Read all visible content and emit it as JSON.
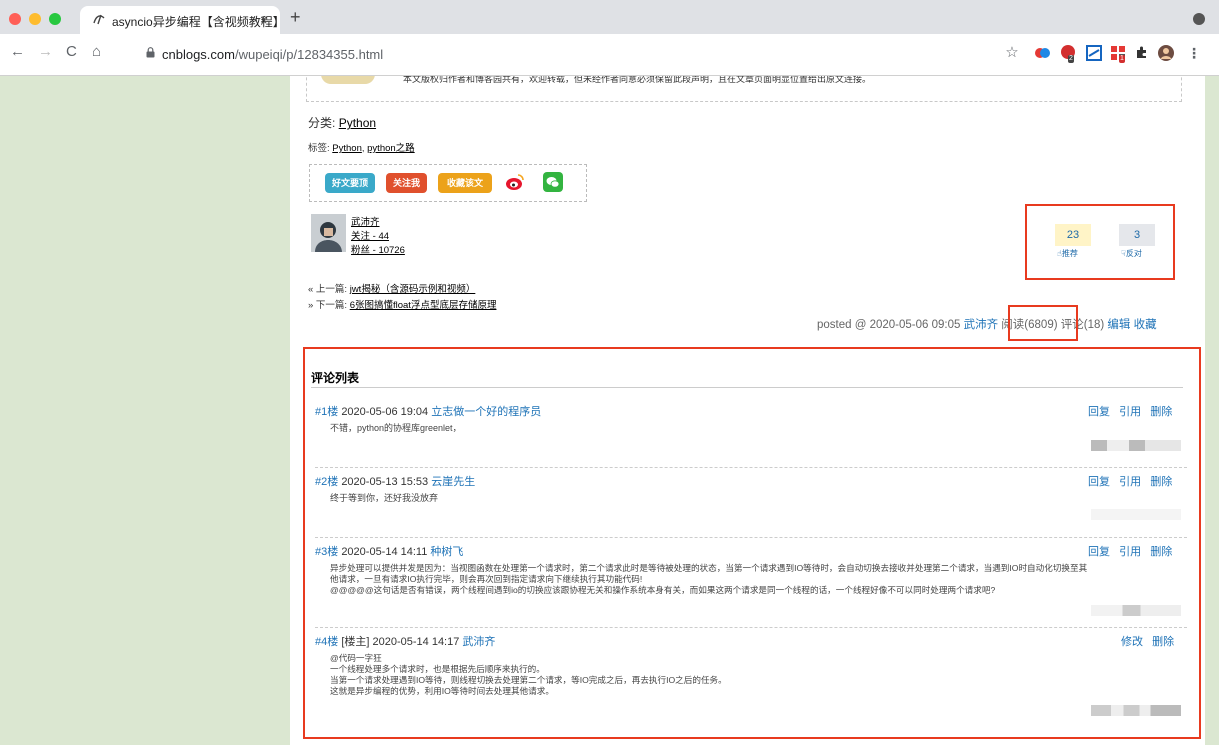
{
  "browser": {
    "tab_title": "asyncio异步编程【含视频教程】",
    "tab_close": "×",
    "new_tab": "+",
    "url_domain": "cnblogs.com",
    "url_path": "/wupeiqi/p/12834355.html",
    "nav": {
      "back": "←",
      "forward": "→",
      "reload": "C",
      "home": "⌂"
    },
    "toolbar_icons": [
      "star-icon",
      "extension-icon",
      "extension-icon",
      "extension-icon",
      "extension-icon",
      "puzzle-icon",
      "profile-icon",
      "menu-icon"
    ],
    "badges": [
      "2",
      "1"
    ]
  },
  "article": {
    "copyright": "本文版权归作者和博客园共有，欢迎转载，但未经作者同意必须保留此段声明，且在文章页面明显位置给出原文连接。",
    "category_label": "分类:",
    "category": "Python",
    "tags_label": "标签:",
    "tag1": "Python",
    "tag_sep": ",",
    "tag2": "python之路",
    "buttons": {
      "digg": "好文要顶",
      "follow": "关注我",
      "favorite": "收藏该文"
    },
    "author": {
      "name": "武沛齐",
      "follow": "关注 - 44",
      "fans": "粉丝 - 10726"
    },
    "votes": {
      "up": "23",
      "up_label": "推荐",
      "down": "3",
      "down_label": "反对"
    },
    "prev_label": "« 上一篇:",
    "prev_title": "jwt揭秘（含源码示例和视频）",
    "next_label": "» 下一篇:",
    "next_title": "6张图搞懂float浮点型底层存储原理",
    "postdesc": {
      "posted": "posted @ 2020-05-06 09:05",
      "author": "武沛齐",
      "read": "阅读(6809)",
      "comments": "评论(18)",
      "edit": "编辑",
      "collect": "收藏"
    }
  },
  "comments": {
    "title": "评论列表",
    "items": [
      {
        "num": "#1楼",
        "owner": "",
        "date": "2020-05-06 19:04",
        "user": "立志做一个好的程序员",
        "actions": [
          "回复",
          "引用",
          "删除"
        ],
        "lines": [
          "不错，python的协程库greenlet，"
        ]
      },
      {
        "num": "#2楼",
        "owner": "",
        "date": "2020-05-13 15:53",
        "user": "云崖先生",
        "actions": [
          "回复",
          "引用",
          "删除"
        ],
        "lines": [
          "终于等到你，还好我没放弃"
        ]
      },
      {
        "num": "#3楼",
        "owner": "",
        "date": "2020-05-14 14:11",
        "user": "种树飞",
        "actions": [
          "回复",
          "引用",
          "删除"
        ],
        "lines": [
          "异步处理可以提供并发是因为：当视图函数在处理第一个请求时，第二个请求此时是等待被处理的状态，当第一个请求遇到IO等待时，会自动切换去接收并处理第二个请求，当遇到IO时自动化切换至其",
          "他请求，一旦有请求IO执行完毕，则会再次回到指定请求向下继续执行其功能代码!",
          "@@@@@这句话是否有错误，两个线程间遇到io的切换应该跟协程无关和操作系统本身有关，而如果这两个请求是同一个线程的话，一个线程好像不可以同时处理两个请求吧?"
        ]
      },
      {
        "num": "#4楼",
        "owner": "[楼主]",
        "date": "2020-05-14 14:17",
        "user": "武沛齐",
        "actions": [
          "修改",
          "删除"
        ],
        "lines": [
          "@代码一字狂",
          "一个线程处理多个请求时，也是根据先后顺序来执行的。",
          "当第一个请求处理遇到IO等待，则线程切换去处理第二个请求，等IO完成之后，再去执行IO之后的任务。",
          "这就是异步编程的优势，利用IO等待时间去处理其他请求。"
        ]
      }
    ]
  }
}
